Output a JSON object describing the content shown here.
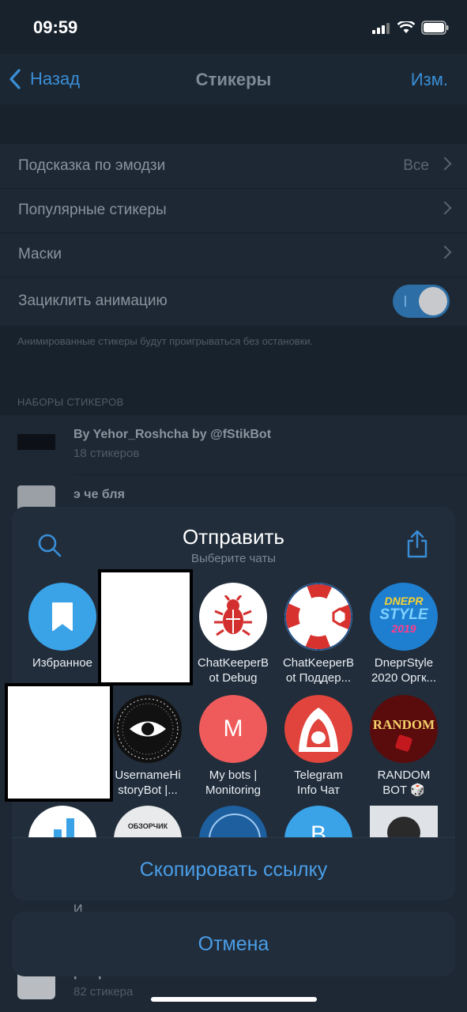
{
  "status": {
    "time": "09:59"
  },
  "nav": {
    "back": "Назад",
    "title": "Стикеры",
    "edit": "Изм."
  },
  "settings": {
    "emoji_hint": {
      "label": "Подсказка по эмодзи",
      "value": "Все"
    },
    "popular": {
      "label": "Популярные стикеры"
    },
    "masks": {
      "label": "Маски"
    },
    "loop": {
      "label": "Зациклить анимацию",
      "enabled": true
    },
    "loop_hint": "Анимированные стикеры будут проигрываться без остановки."
  },
  "packs": {
    "caption": "НАБОРЫ СТИКЕРОВ",
    "items": [
      {
        "title": "By Yehor_Roshcha by @fStikBot",
        "count": "18 стикеров"
      },
      {
        "title": "э че бля",
        "count": ""
      },
      {
        "title": "pewpew",
        "count": "82 стикера"
      }
    ],
    "partial_behind": "И..."
  },
  "share": {
    "title": "Отправить",
    "subtitle": "Выберите чаты",
    "chats": [
      {
        "label": "Избранное",
        "icon": "bookmark-icon",
        "color": "#3aa3e8"
      },
      {
        "label": "",
        "icon": "redacted",
        "color": "#ffffff"
      },
      {
        "label": "ChatKeeperB\not Debug",
        "icon": "bug-icon",
        "color": "#ffffff"
      },
      {
        "label": "ChatKeeperB\not Поддер...",
        "icon": "lifebuoy-icon",
        "color": "#ffffff"
      },
      {
        "label": "DneprStyle\n2020 Оргк...",
        "icon": "dnepr-style-logo",
        "color": "#1e7fd0"
      },
      {
        "label": "",
        "icon": "redacted",
        "color": "#ffffff"
      },
      {
        "label": "UsernameHi\nstoryBot |...",
        "icon": "eye-icon",
        "color": "#111111"
      },
      {
        "label": "My bots |\nMonitoring",
        "icon": "M",
        "color": "#ef5b5b"
      },
      {
        "label": "Telegram\nInfo Чат",
        "icon": "hood-icon",
        "color": "#e0443c"
      },
      {
        "label": "RANDOM\nBOT 🎲",
        "icon": "random-logo",
        "color": "#5a0b0b"
      }
    ],
    "dnepr_text": {
      "line1": "DNEPR",
      "line2": "STYLE",
      "line3": "2019"
    },
    "random_text": "RANDOM",
    "row3_label": "ОБЗОРЧИК",
    "row3_letter": "B",
    "copy_link": "Скопировать ссылку",
    "cancel": "Отмена"
  }
}
